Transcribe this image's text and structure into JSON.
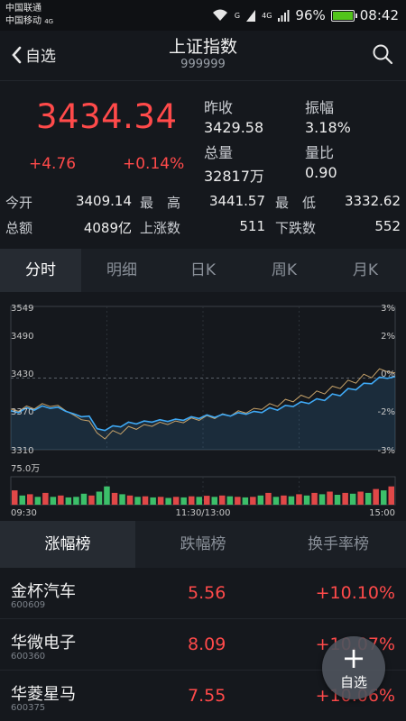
{
  "status": {
    "carrier1": "中国联通",
    "carrier2": "中国移动",
    "carrier2_net": "4G",
    "net_small1": "G",
    "net_small2": "4G",
    "battery": "96%",
    "time": "08:42"
  },
  "header": {
    "back_label": "自选",
    "title": "上证指数",
    "code": "999999"
  },
  "quote": {
    "price": "3434.34",
    "change": "+4.76",
    "change_pct": "+0.14%",
    "prev_close_label": "昨收",
    "prev_close": "3429.58",
    "amplitude_label": "振幅",
    "amplitude": "3.18%",
    "volume_label": "总量",
    "volume": "32817万",
    "vol_ratio_label": "量比",
    "vol_ratio": "0.90",
    "open_label": "今开",
    "open": "3409.14",
    "high_label": "最　高",
    "high": "3441.57",
    "low_label": "最　低",
    "low": "3332.62",
    "amount_label": "总额",
    "amount": "4089亿",
    "up_label": "上涨数",
    "up": "511",
    "down_label": "下跌数",
    "down": "552"
  },
  "chart_tabs": [
    "分时",
    "明细",
    "日K",
    "周K",
    "月K"
  ],
  "chart_data": {
    "type": "line",
    "x_start": "09:30",
    "x_mid": "11:30/13:00",
    "x_end": "15:00",
    "y_ticks": [
      "3549",
      "3490",
      "3430",
      "3370",
      "3310"
    ],
    "y_pct_ticks": [
      "3%",
      "2%",
      "0%",
      "-2%",
      "-3%"
    ],
    "ylim": [
      3310,
      3549
    ],
    "prev_close": 3429.58,
    "volume_label": "75.0万",
    "series": [
      {
        "name": "",
        "color": "#3fa9f5",
        "values": [
          3375,
          3372,
          3380,
          3376,
          3383,
          3379,
          3381,
          3374,
          3370,
          3365,
          3366,
          3345,
          3342,
          3350,
          3348,
          3356,
          3353,
          3358,
          3356,
          3360,
          3357,
          3361,
          3359,
          3365,
          3362,
          3368,
          3364,
          3369,
          3366,
          3372,
          3369,
          3374,
          3372,
          3380,
          3376,
          3384,
          3382,
          3390,
          3387,
          3395,
          3392,
          3403,
          3400,
          3412,
          3410,
          3421,
          3420,
          3431,
          3429,
          3432
        ]
      },
      {
        "name": "",
        "color": "#c9a46a",
        "values": [
          3378,
          3374,
          3383,
          3378,
          3387,
          3382,
          3384,
          3375,
          3368,
          3360,
          3358,
          3338,
          3328,
          3342,
          3336,
          3349,
          3344,
          3352,
          3349,
          3356,
          3352,
          3358,
          3355,
          3363,
          3359,
          3367,
          3362,
          3370,
          3366,
          3375,
          3371,
          3379,
          3377,
          3387,
          3382,
          3394,
          3390,
          3401,
          3396,
          3408,
          3403,
          3416,
          3412,
          3426,
          3421,
          3436,
          3430,
          3445,
          3440,
          3438
        ]
      }
    ],
    "volumes": [
      0.55,
      0.35,
      0.4,
      0.3,
      0.45,
      0.3,
      0.35,
      0.28,
      0.3,
      0.42,
      0.35,
      0.5,
      0.7,
      0.45,
      0.4,
      0.35,
      0.3,
      0.32,
      0.28,
      0.3,
      0.26,
      0.3,
      0.28,
      0.32,
      0.3,
      0.34,
      0.3,
      0.35,
      0.32,
      0.3,
      0.28,
      0.3,
      0.35,
      0.45,
      0.3,
      0.35,
      0.32,
      0.4,
      0.35,
      0.45,
      0.4,
      0.5,
      0.38,
      0.45,
      0.42,
      0.5,
      0.45,
      0.6,
      0.55,
      0.7
    ]
  },
  "rank_tabs": [
    "涨幅榜",
    "跌幅榜",
    "换手率榜"
  ],
  "stocks": [
    {
      "name": "金杯汽车",
      "code": "600609",
      "price": "5.56",
      "pct": "+10.10%"
    },
    {
      "name": "华微电子",
      "code": "600360",
      "price": "8.09",
      "pct": "+10.07%"
    },
    {
      "name": "华菱星马",
      "code": "600375",
      "price": "7.55",
      "pct": "+10.06%"
    }
  ],
  "fab": {
    "plus": "+",
    "label": "自选"
  },
  "colors": {
    "up": "#ff4a4a",
    "accent": "#3fa9f5",
    "bg": "#15181d"
  }
}
